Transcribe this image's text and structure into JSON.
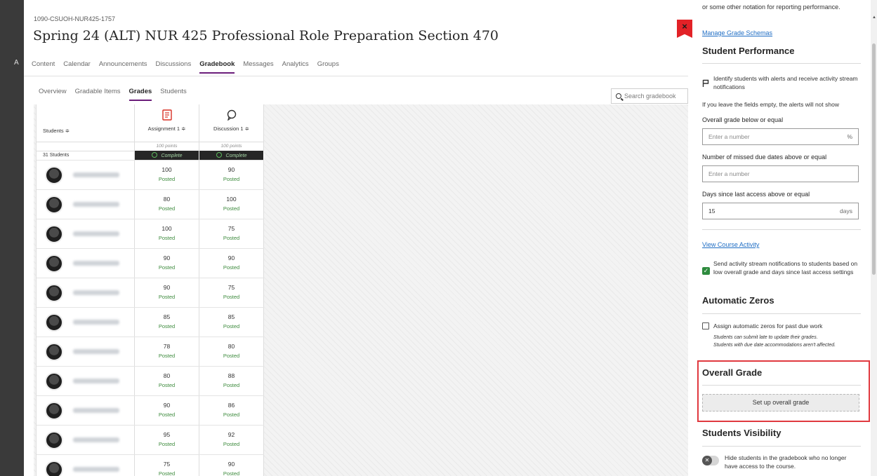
{
  "course": {
    "id": "1090-CSUOH-NUR425-1757",
    "title": "Spring 24 (ALT) NUR 425 Professional Role Preparation Section 470",
    "nav": [
      "Content",
      "Calendar",
      "Announcements",
      "Discussions",
      "Gradebook",
      "Messages",
      "Analytics",
      "Groups"
    ],
    "active_nav": "Gradebook"
  },
  "gradebook": {
    "tabs": [
      "Overview",
      "Gradable Items",
      "Grades",
      "Students"
    ],
    "active_tab": "Grades",
    "search_placeholder": "Search gradebook",
    "students_header": "Students ≑",
    "student_count": "31 Students",
    "columns": [
      {
        "name": "Assignment 1 ≑",
        "points": "100 points",
        "status": "Complete",
        "icon": "assignment-icon"
      },
      {
        "name": "Discussion 1 ≑",
        "points": "100 points",
        "status": "Complete",
        "icon": "discussion-icon"
      }
    ],
    "posted_label": "Posted",
    "rows": [
      {
        "a1": "100",
        "d1": "90"
      },
      {
        "a1": "80",
        "d1": "100"
      },
      {
        "a1": "100",
        "d1": "75"
      },
      {
        "a1": "90",
        "d1": "90"
      },
      {
        "a1": "90",
        "d1": "75"
      },
      {
        "a1": "85",
        "d1": "85"
      },
      {
        "a1": "78",
        "d1": "80"
      },
      {
        "a1": "80",
        "d1": "88"
      },
      {
        "a1": "90",
        "d1": "86"
      },
      {
        "a1": "95",
        "d1": "92"
      },
      {
        "a1": "75",
        "d1": "90"
      }
    ]
  },
  "panel": {
    "top_text": "or some other notation for reporting performance.",
    "manage_link": "Manage Grade Schemas",
    "student_performance": {
      "heading": "Student Performance",
      "flag_text": "Identify students with alerts and receive activity stream notifications",
      "hint": "If you leave the fields empty, the alerts will not show",
      "overall_label": "Overall grade below or equal",
      "overall_placeholder": "Enter a number",
      "overall_unit": "%",
      "missed_label": "Number of missed due dates above or equal",
      "missed_placeholder": "Enter a number",
      "days_label": "Days since last access above or equal",
      "days_value": "15",
      "days_unit": "days",
      "activity_link": "View Course Activity",
      "notify_text": "Send activity stream notifications to students based on low overall grade and days since last access settings",
      "notify_checked": true
    },
    "automatic_zeros": {
      "heading": "Automatic Zeros",
      "checkbox_label": "Assign automatic zeros for past due work",
      "note1": "Students can submit late to update their grades.",
      "note2": "Students with due date accommodations aren't affected."
    },
    "overall_grade": {
      "heading": "Overall Grade",
      "button": "Set up overall grade"
    },
    "students_visibility": {
      "heading": "Students Visibility",
      "toggle_text": "Hide students in the gradebook who no longer have access to the course."
    }
  },
  "close_label": "×",
  "colors": {
    "accent": "#6b1d7a",
    "link": "#1e6dc4",
    "posted_green": "#3c8a3c",
    "highlight_red": "#e0393f",
    "close_red": "#e22227"
  }
}
